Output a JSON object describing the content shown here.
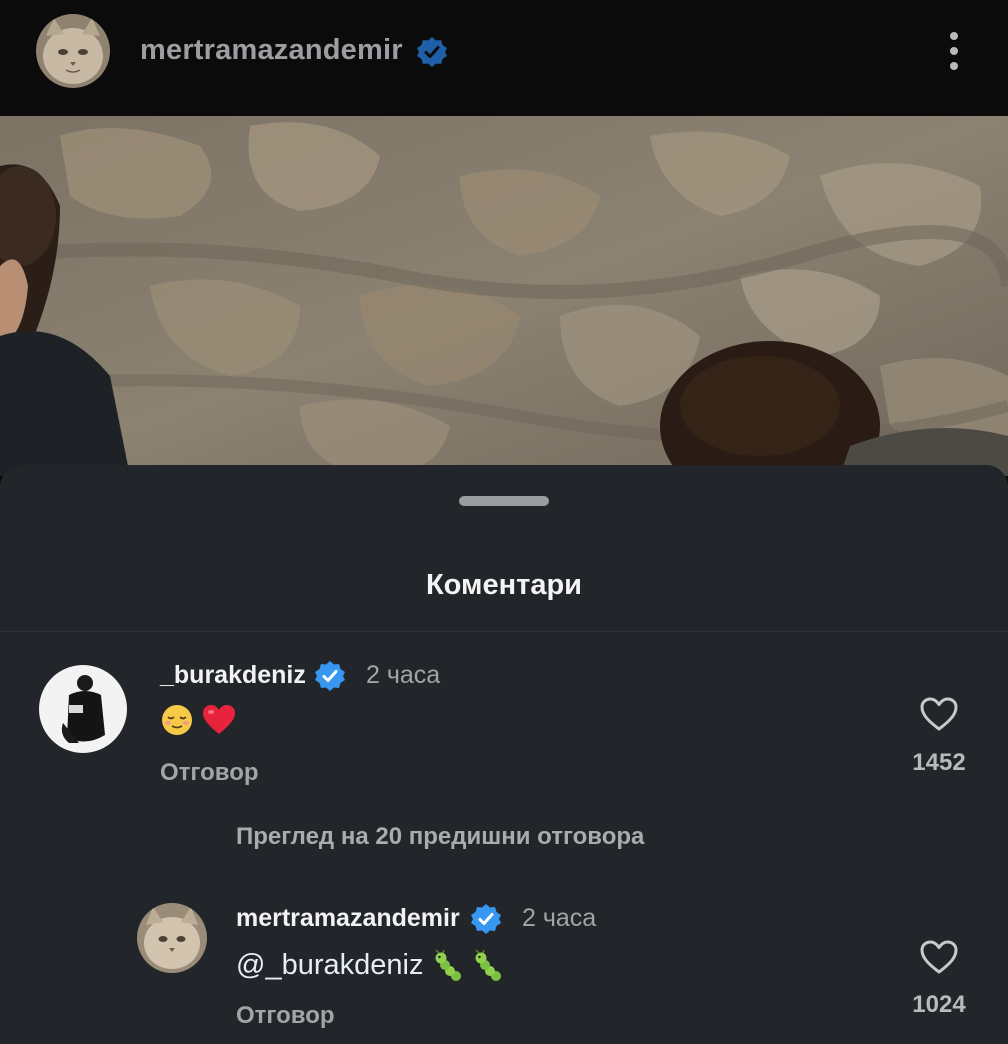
{
  "header": {
    "username": "mertramazandemir",
    "verified": true
  },
  "sheet": {
    "title": "Коментари"
  },
  "comments": [
    {
      "username": "_burakdeniz",
      "verified": true,
      "time": "2 часа",
      "emojis": [
        "relieved-face",
        "red-heart"
      ],
      "reply_label": "Отговор",
      "likes": "1452"
    }
  ],
  "view_more_replies": "Преглед на 20 предишни отговора",
  "replies": [
    {
      "username": "mertramazandemir",
      "verified": true,
      "time": "2 часа",
      "mention": "@_burakdeniz",
      "emojis": [
        "caterpillar",
        "caterpillar"
      ],
      "reply_label": "Отговор",
      "likes": "1024"
    }
  ],
  "colors": {
    "verified": "#3897f0",
    "sheet_bg": "#22252a",
    "header_bg": "#0b0b0c"
  }
}
